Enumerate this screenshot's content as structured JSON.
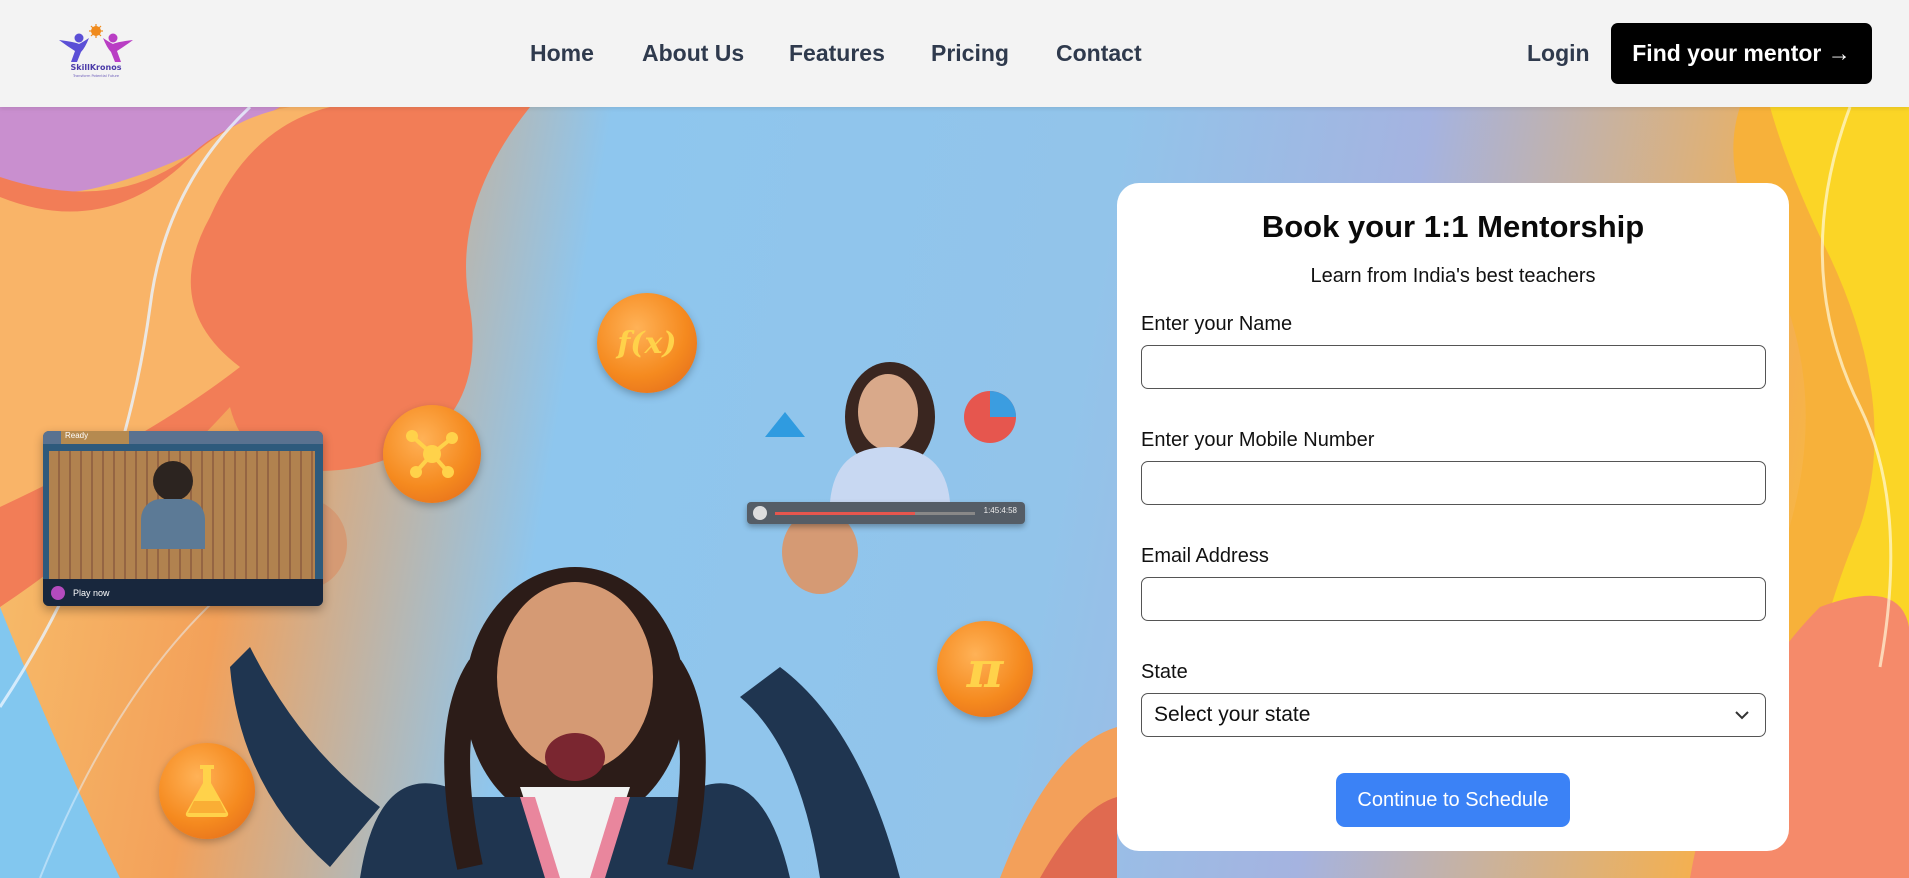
{
  "header": {
    "logo": {
      "name": "SkillKronos",
      "tagline": "Transform Potential Future"
    },
    "nav": [
      {
        "label": "Home"
      },
      {
        "label": "About Us"
      },
      {
        "label": "Features"
      },
      {
        "label": "Pricing"
      },
      {
        "label": "Contact"
      }
    ],
    "login_label": "Login",
    "cta_label": "Find your mentor →"
  },
  "hero": {
    "bubble_icons": [
      "function-icon",
      "molecule-icon",
      "pi-icon",
      "flask-icon"
    ],
    "video_card": {
      "play_label": "Play now",
      "tab_label": "Ready"
    },
    "video_bar": {
      "time": "1:45:4:58"
    }
  },
  "form": {
    "title": "Book your 1:1 Mentorship",
    "subtitle": "Learn from India's best teachers",
    "fields": [
      {
        "label": "Enter your Name",
        "value": "",
        "placeholder": ""
      },
      {
        "label": "Enter your Mobile Number",
        "value": "",
        "placeholder": ""
      },
      {
        "label": "Email Address",
        "value": "",
        "placeholder": ""
      }
    ],
    "state": {
      "label": "State",
      "selected": "Select your state"
    },
    "submit_label": "Continue to Schedule"
  },
  "colors": {
    "cta_bg": "#000000",
    "submit_bg": "#3b82f6",
    "nav_text": "#2f3a4d"
  }
}
